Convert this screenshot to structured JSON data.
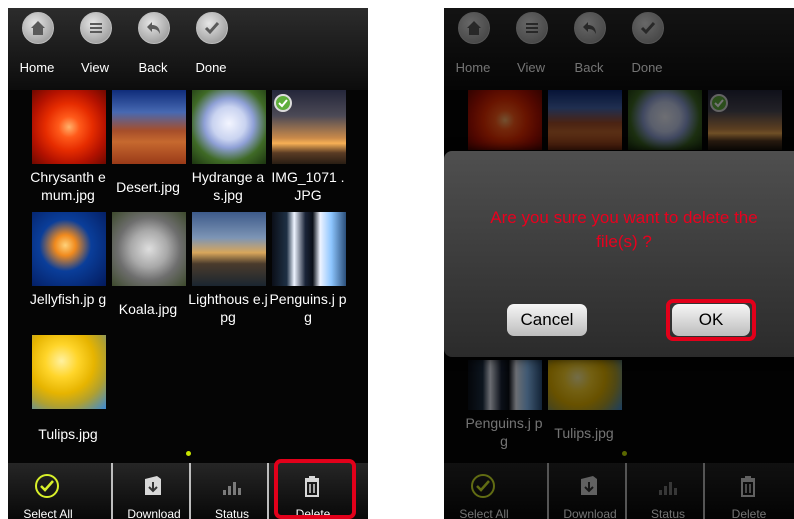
{
  "colors": {
    "highlight": "#e2001a",
    "dialog_text": "#e8001e",
    "check_green": "#5fae3c",
    "page_dot": "#c8e400"
  },
  "top_nav": [
    {
      "label": "Home",
      "icon": "home-icon"
    },
    {
      "label": "View",
      "icon": "list-icon"
    },
    {
      "label": "Back",
      "icon": "back-arrow-icon"
    },
    {
      "label": "Done",
      "icon": "checkmark-icon"
    }
  ],
  "files": [
    {
      "name": "Chrysanth emum.jpg",
      "selected": false
    },
    {
      "name": "Desert.jpg",
      "selected": false
    },
    {
      "name": "Hydrange as.jpg",
      "selected": false
    },
    {
      "name": "IMG_1071 .JPG",
      "selected": true
    },
    {
      "name": "Jellyfish.jp g",
      "selected": false
    },
    {
      "name": "Koala.jpg",
      "selected": false
    },
    {
      "name": "Lighthous e.jpg",
      "selected": false
    },
    {
      "name": "Penguins.j pg",
      "selected": false
    },
    {
      "name": "Tulips.jpg",
      "selected": false
    }
  ],
  "bottom_bar": [
    {
      "label": "Select All",
      "icon": "check-circle-icon"
    },
    {
      "label": "Download",
      "icon": "download-icon"
    },
    {
      "label": "Status",
      "icon": "bar-chart-icon"
    },
    {
      "label": "Delete",
      "icon": "trash-icon"
    }
  ],
  "dialog": {
    "message": "Are you sure you want to delete the file(s) ?",
    "cancel_label": "Cancel",
    "ok_label": "OK"
  }
}
